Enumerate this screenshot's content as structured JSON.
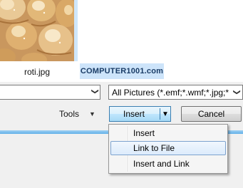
{
  "file_view": {
    "thumbnail_label": "roti.jpg",
    "watermark": "COMPUTER1001.com"
  },
  "filename_field": {
    "value": "",
    "arrow": "❯"
  },
  "file_type_filter": {
    "selected": "All Pictures (*.emf;*.wmf;*.jpg;*",
    "arrow": "❯"
  },
  "tools": {
    "label": "Tools",
    "caret": "▼"
  },
  "insert_button": {
    "label": "Insert",
    "drop_glyph": "▼"
  },
  "cancel_button": {
    "label": "Cancel"
  },
  "insert_menu": {
    "items": [
      {
        "label": "Insert"
      },
      {
        "label": "Link to File",
        "highlighted": true
      },
      {
        "label": "Insert and Link"
      }
    ]
  },
  "colors": {
    "accent_border": "#3c7fb1",
    "menu_highlight": "#dcebfc",
    "watermark_bg": "#cde4fa"
  }
}
